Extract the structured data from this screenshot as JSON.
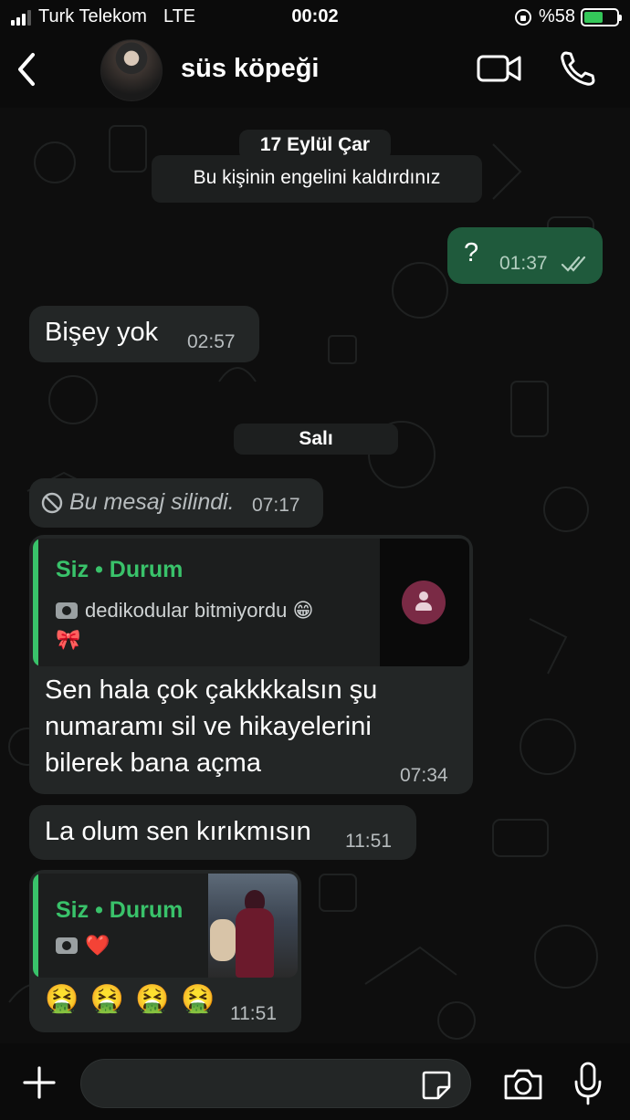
{
  "status": {
    "carrier": "Turk Telekom",
    "network": "LTE",
    "time": "00:02",
    "battery": "%58",
    "battery_level": 0.58
  },
  "header": {
    "back_icon": "chevron-left-icon",
    "contact_name": "süs köpeği",
    "video_icon": "video-camera-icon",
    "call_icon": "phone-icon"
  },
  "chat": {
    "date_1": "17 Eylül Çar",
    "system_note": "Bu kişinin engelini kaldırdınız",
    "m1": {
      "text": "?",
      "time": "01:37"
    },
    "m2": {
      "text": "Bişey yok",
      "time": "02:57"
    },
    "date_2": "Salı",
    "m3": {
      "text": "Bu mesaj silindi.",
      "time": "07:17"
    },
    "m4": {
      "quote_title": "Siz • Durum",
      "quote_line1": "dedikodular bitmiyordu 😁",
      "quote_line2": "🎀",
      "line1": "Sen hala çok çakkkkalsın şu",
      "line2": "numaramı sil ve hikayelerini",
      "line3": "bilerek bana açma",
      "time": "07:34"
    },
    "m5": {
      "text": "La olum sen kırıkmısın",
      "time": "11:51"
    },
    "m6": {
      "quote_title": "Siz • Durum",
      "quote_line1": "❤️",
      "text": "🤮 🤮 🤮 🤮",
      "time": "11:51"
    }
  },
  "bottom": {
    "plus_icon": "plus-icon",
    "sticker_icon": "sticker-icon",
    "camera_icon": "camera-icon",
    "mic_icon": "microphone-icon"
  }
}
